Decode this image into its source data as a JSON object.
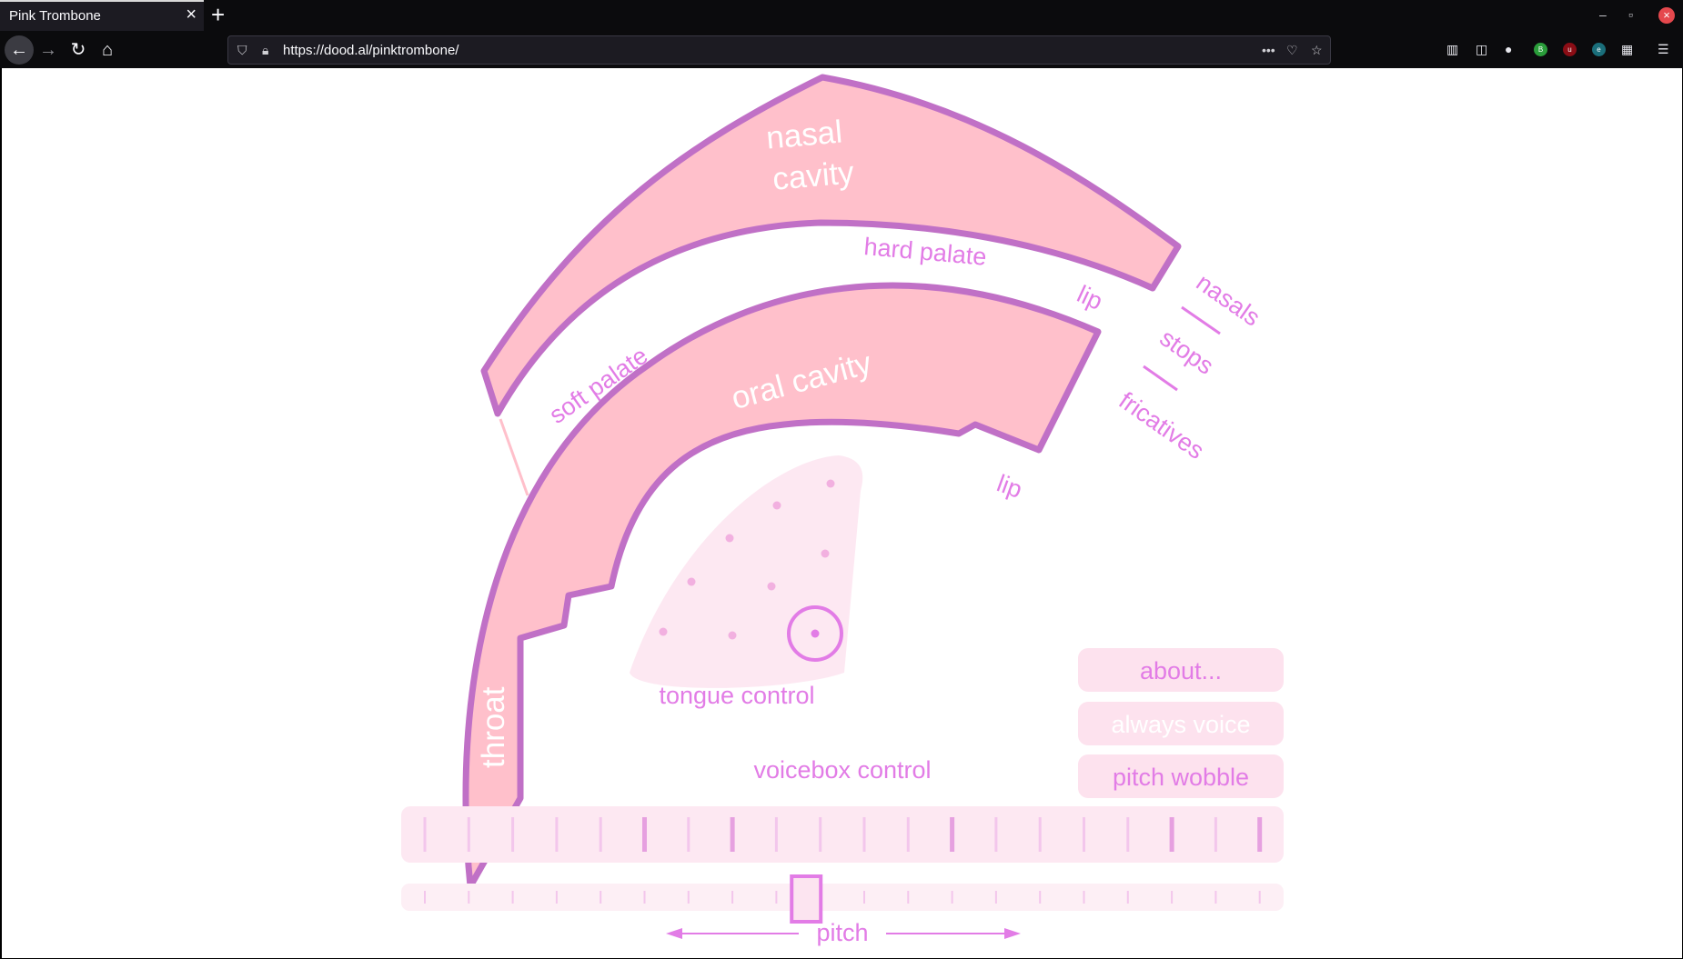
{
  "browser": {
    "tab_title": "Pink Trombone",
    "url": "https://dood.al/pinktrombone/"
  },
  "tract_labels": {
    "nasal": "nasal",
    "cavity": "cavity",
    "hard_palate": "hard palate",
    "soft_palate": "soft  palate",
    "oral_cavity": "oral  cavity",
    "throat": "throat",
    "lip_top": "lip",
    "lip_bottom": "lip",
    "nasals": "nasals",
    "stops": "stops",
    "fricatives": "fricatives",
    "tongue_control": "tongue control",
    "voicebox_control": "voicebox control",
    "pitch": "pitch"
  },
  "buttons": {
    "about": "about...",
    "always_voice": "always voice",
    "pitch_wobble": "pitch wobble"
  },
  "controls": {
    "pitch_position": 0.459
  },
  "colors": {
    "tract_fill": "#ffc0cb",
    "tract_outline": "#c070c6",
    "label_pink": "#e27ce6",
    "control_bg": "#fde8f2"
  }
}
